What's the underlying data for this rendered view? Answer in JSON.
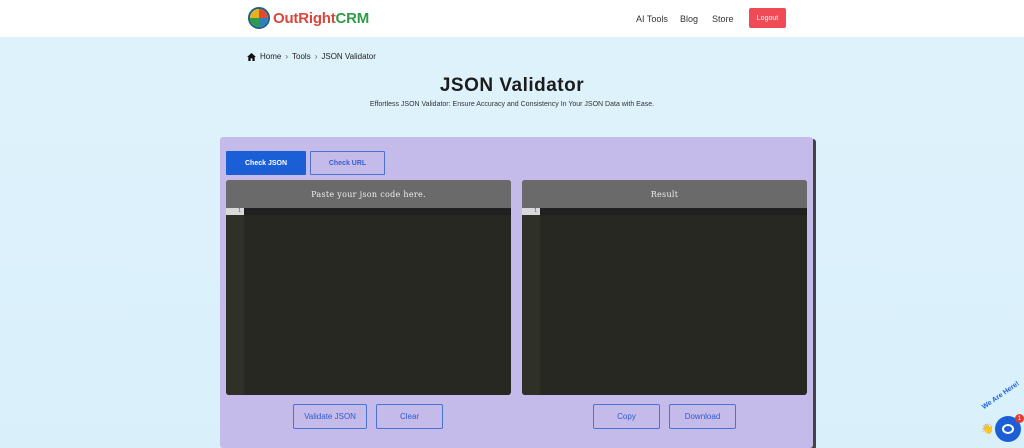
{
  "brand": {
    "part1": "OutRight",
    "part2": "CRM"
  },
  "nav": {
    "ai_tools": "AI Tools",
    "blog": "Blog",
    "store": "Store",
    "logout": "Logout"
  },
  "breadcrumb": {
    "home": "Home",
    "sep1": "›",
    "tools": "Tools",
    "sep2": "›",
    "current": "JSON Validator"
  },
  "page": {
    "title": "JSON Validator",
    "subtitle": "Effortless JSON Validator: Ensure Accuracy and Consistency In Your JSON Data with Ease."
  },
  "tabs": {
    "check_json": "Check JSON",
    "check_url": "Check URL"
  },
  "editors": {
    "input": {
      "header": "Paste your json code here.",
      "line": "1"
    },
    "result": {
      "header": "Result",
      "line": "1"
    }
  },
  "buttons": {
    "validate": "Validate JSON",
    "clear": "Clear",
    "copy": "Copy",
    "download": "Download"
  },
  "chat": {
    "label": "We Are Here!",
    "badge": "1"
  },
  "colors": {
    "primary": "#1b5fd6",
    "logout": "#ef4a55",
    "panel": "#c4bbea",
    "editor": "#272822"
  }
}
